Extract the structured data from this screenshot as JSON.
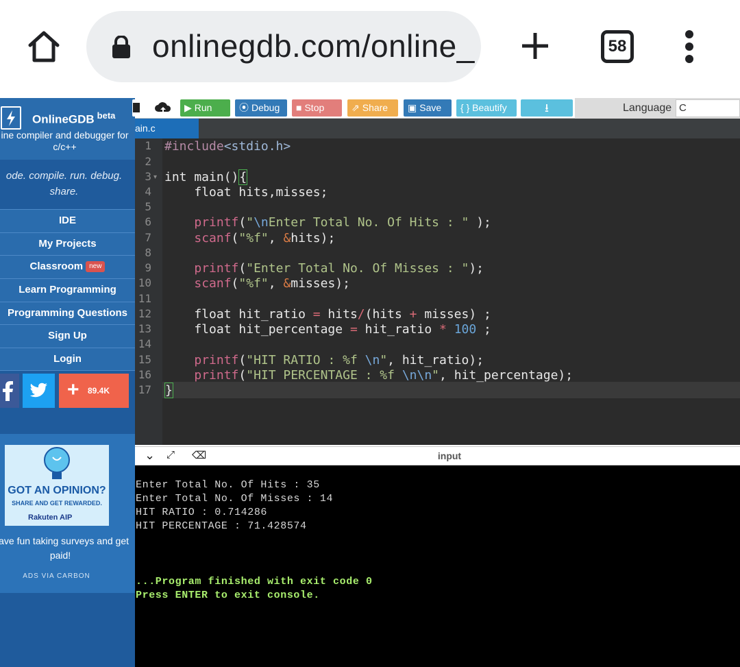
{
  "browser": {
    "url": "onlinegdb.com/online_",
    "tab_count": "58"
  },
  "sidebar": {
    "brand_name": "OnlineGDB",
    "brand_beta": "beta",
    "tagline": "ine compiler and debugger for c/c++",
    "motto": "ode. compile. run. debug. share.",
    "nav": [
      {
        "label": "IDE"
      },
      {
        "label": "My Projects"
      },
      {
        "label": "Classroom",
        "badge": "new"
      },
      {
        "label": "Learn Programming"
      },
      {
        "label": "Programming Questions"
      },
      {
        "label": "Sign Up"
      },
      {
        "label": "Login"
      }
    ],
    "social": {
      "share_count": "89.4K"
    },
    "ad": {
      "headline": "GOT AN OPINION?",
      "subline": "SHARE AND GET REWARDED.",
      "brand": "Rakuten AIP",
      "text": "Have fun taking surveys and get paid!",
      "via": "ADS VIA CARBON"
    }
  },
  "toolbar": {
    "run": "Run",
    "debug": "Debug",
    "stop": "Stop",
    "share": "Share",
    "save": "Save",
    "beautify": "{ } Beautify",
    "language_label": "Language",
    "language_value": "C"
  },
  "editor": {
    "file_tab": "ain.c",
    "line_numbers": [
      "1",
      "2",
      "3",
      "4",
      "5",
      "6",
      "7",
      "8",
      "9",
      "10",
      "11",
      "12",
      "13",
      "14",
      "15",
      "16",
      "17"
    ]
  },
  "console": {
    "title": "input",
    "lines": [
      "Enter Total No. Of Hits : 35",
      "Enter Total No. Of Misses : 14",
      "HIT RATIO : 0.714286",
      "HIT PERCENTAGE : 71.428574"
    ],
    "finished": "...Program finished with exit code 0",
    "press_enter": "Press ENTER to exit console."
  },
  "colors": {
    "sidebar_bg": "#1f5b9c",
    "run_btn": "#4cae4c",
    "debug_btn": "#337ab7",
    "stop_btn": "#d9534f",
    "share_btn": "#f0ad4e",
    "save_btn": "#337ab7",
    "beautify_btn": "#5bc0de",
    "editor_bg": "#2b2b2b",
    "console_bg": "#000000"
  }
}
